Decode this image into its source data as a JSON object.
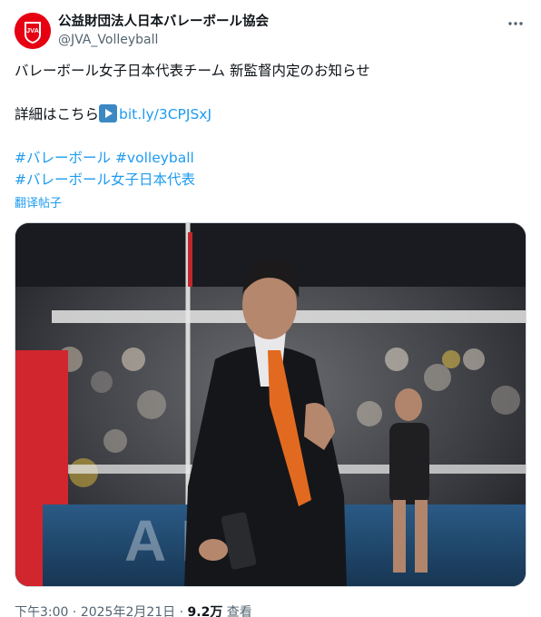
{
  "account": {
    "display_name": "公益財団法人日本バレーボール協会",
    "handle": "@JVA_Volleyball",
    "avatar_text": "JVA"
  },
  "post": {
    "line1": "バレーボール女子日本代表チーム 新監督内定のお知らせ",
    "details_prefix": "詳細はこちら",
    "details_link": "bit.ly/3CPJSxJ",
    "hashtag_1": "#バレーボール",
    "hashtag_2": "#volleyball",
    "hashtag_3": "#バレーボール女子日本代表",
    "translate_label": "翻译帖子"
  },
  "media": {
    "court_banner_text": "ADO"
  },
  "meta": {
    "time": "下午3:00",
    "separator": "·",
    "date": "2025年2月21日",
    "views_count": "9.2万",
    "views_label": "查看"
  },
  "colors": {
    "link": "#1d9bf0",
    "text": "#0f1419",
    "secondary": "#536471",
    "brand_red": "#e60012"
  },
  "icons": [
    "more-icon",
    "play-icon",
    "jva-logo"
  ]
}
